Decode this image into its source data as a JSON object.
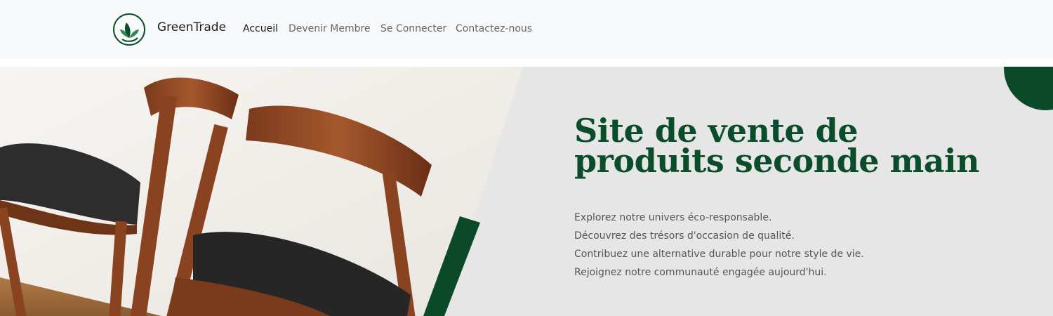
{
  "brand": {
    "name": "GreenTrade",
    "logo_icon": "leaf-logo-icon",
    "color": "#0b4d2b"
  },
  "nav": {
    "items": [
      {
        "label": "Accueil",
        "active": true
      },
      {
        "label": "Devenir Membre",
        "active": false
      },
      {
        "label": "Se Connecter",
        "active": false
      },
      {
        "label": "Contactez-nous",
        "active": false
      }
    ]
  },
  "hero": {
    "title_line1": "Site de vente de",
    "title_line2": "produits seconde main",
    "lines": [
      "Explorez notre univers éco-responsable.",
      "Découvrez des trésors d'occasion de qualité.",
      "Contribuez une alternative durable pour notre style de vie.",
      "Rejoignez notre communauté engagée aujourd'hui."
    ],
    "image": "wooden-chairs-photo",
    "accent_color": "#0a4a28",
    "background_color": "#e6e6e6"
  }
}
